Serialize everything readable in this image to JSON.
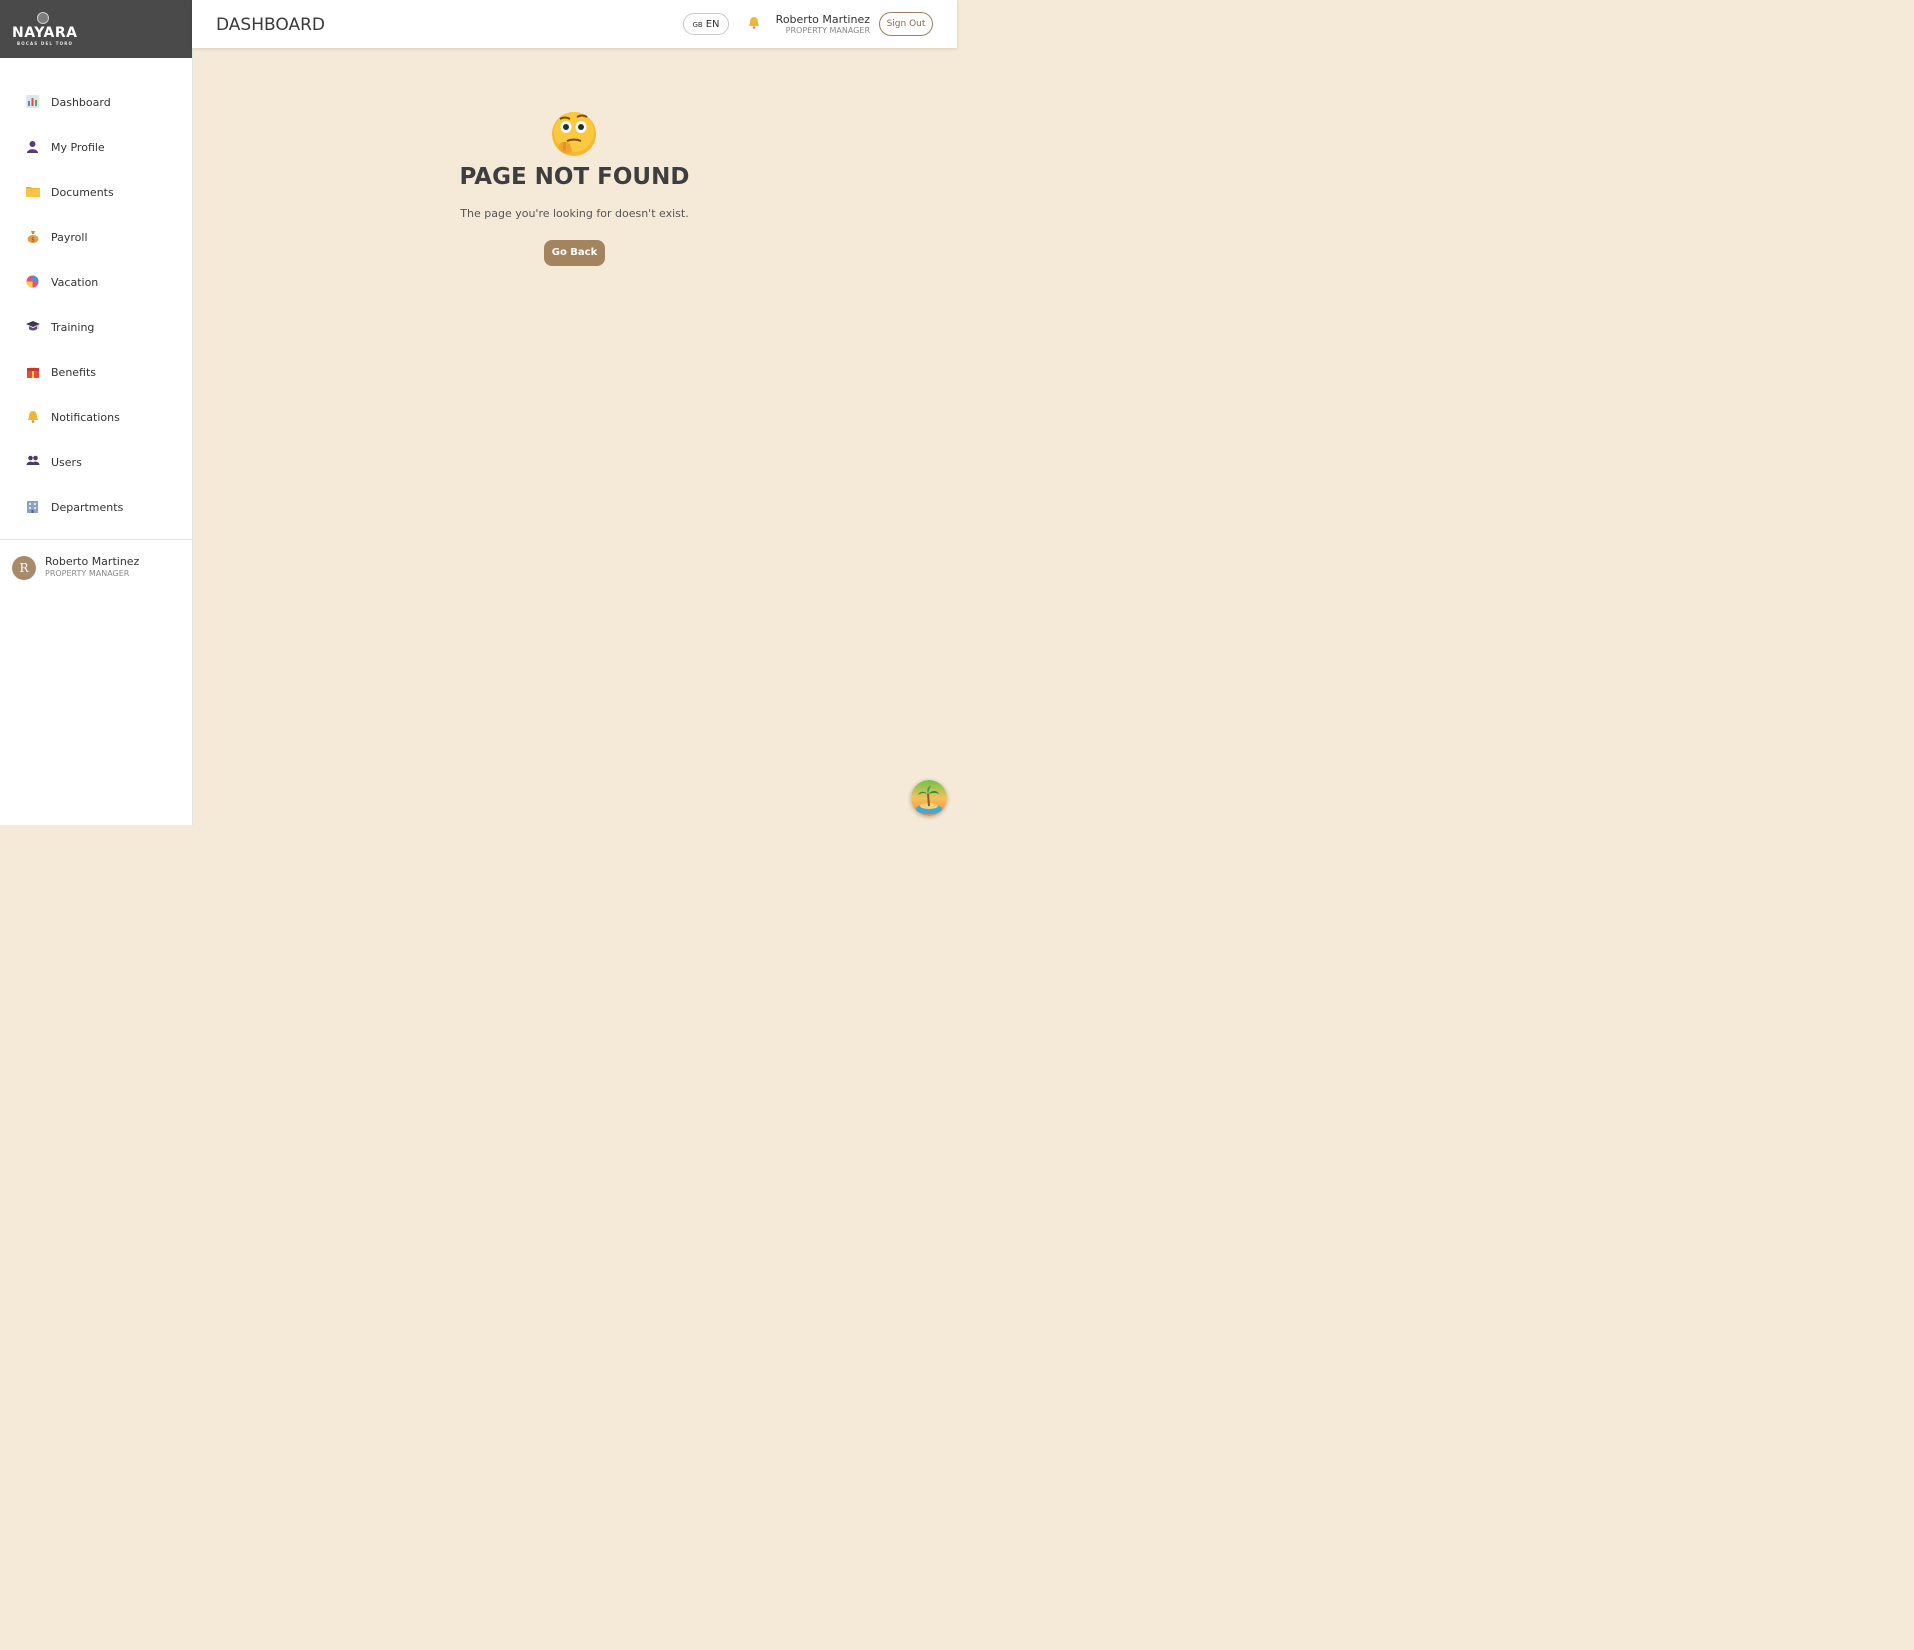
{
  "brand": {
    "name": "NAYARA",
    "subtitle": "BOCAS DEL TORO"
  },
  "sidebar": {
    "items": [
      {
        "label": "Dashboard",
        "icon": "bar-chart-icon"
      },
      {
        "label": "My Profile",
        "icon": "person-icon"
      },
      {
        "label": "Documents",
        "icon": "folder-icon"
      },
      {
        "label": "Payroll",
        "icon": "money-bag-icon"
      },
      {
        "label": "Vacation",
        "icon": "beach-ball-icon"
      },
      {
        "label": "Training",
        "icon": "graduation-cap-icon"
      },
      {
        "label": "Benefits",
        "icon": "gift-icon"
      },
      {
        "label": "Notifications",
        "icon": "bell-icon"
      },
      {
        "label": "Users",
        "icon": "users-icon"
      },
      {
        "label": "Departments",
        "icon": "building-icon"
      }
    ],
    "user": {
      "initial": "R",
      "name": "Roberto Martinez",
      "role": "PROPERTY MANAGER"
    }
  },
  "header": {
    "title": "DASHBOARD",
    "language": {
      "flag": "GB",
      "code": "EN"
    },
    "user_name": "Roberto Martinez",
    "user_role": "PROPERTY MANAGER",
    "signout_label": "Sign Out"
  },
  "notfound": {
    "title": "PAGE NOT FOUND",
    "description": "The page you're looking for doesn't exist.",
    "button_label": "Go Back"
  },
  "colors": {
    "background": "#f5ead8",
    "brand_bar": "#4a4a4a",
    "accent": "#a3845f",
    "bell": "#e0a43a"
  }
}
